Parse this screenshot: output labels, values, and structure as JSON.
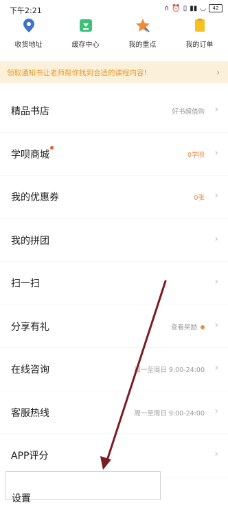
{
  "status_bar": {
    "time": "下午2:21",
    "battery": "42"
  },
  "shortcuts": [
    {
      "label": "收货地址",
      "icon": "location-pin-icon"
    },
    {
      "label": "缓存中心",
      "icon": "download-icon"
    },
    {
      "label": "我的重点",
      "icon": "star-icon"
    },
    {
      "label": "我的订单",
      "icon": "order-icon"
    }
  ],
  "banner": {
    "text": "领取通知书让老师帮你找到合适的课程内容!"
  },
  "menu": [
    {
      "label": "精品书店",
      "value": "好书超值购"
    },
    {
      "label": "学呗商城",
      "value": "0学呗"
    },
    {
      "label": "我的优惠券",
      "value": "0张"
    },
    {
      "label": "我的拼团",
      "value": ""
    },
    {
      "label": "扫一扫",
      "value": ""
    },
    {
      "label": "分享有礼",
      "value": "查看奖励"
    },
    {
      "label": "在线咨询",
      "value": "周一至周日 9:00-24:00"
    },
    {
      "label": "客服热线",
      "value": "周一至周日 9:00-24:00"
    },
    {
      "label": "APP评分",
      "value": ""
    }
  ],
  "last_item": {
    "label": "设置"
  },
  "colors": {
    "accent": "#f08a3c",
    "banner_bg": "#fbf0d9",
    "arrow": "#7a1c22"
  }
}
